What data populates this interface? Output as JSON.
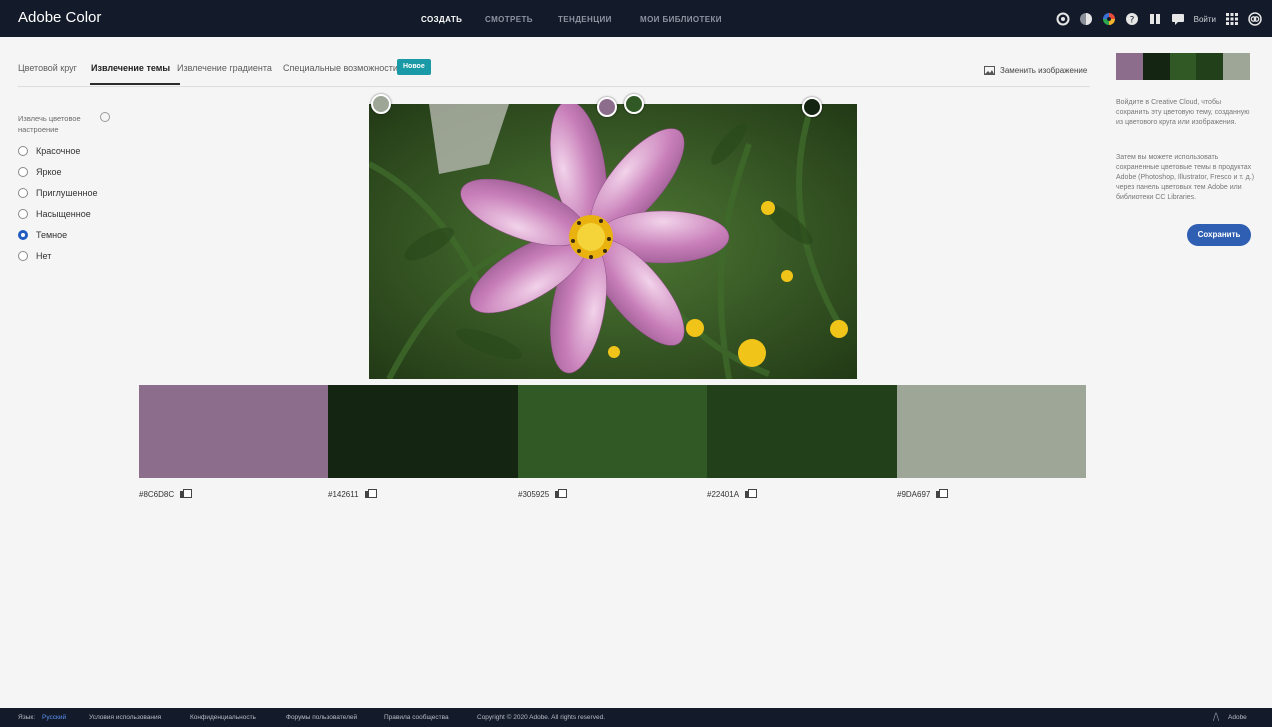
{
  "app": {
    "title": "Adobe Color"
  },
  "topnav": {
    "items": [
      {
        "label": "СОЗДАТЬ",
        "active": true
      },
      {
        "label": "СМОТРЕТЬ",
        "active": false
      },
      {
        "label": "ТЕНДЕНЦИИ",
        "active": false
      },
      {
        "label": "МОИ БИБЛИОТЕКИ",
        "active": false
      }
    ],
    "signin": "Войти",
    "icons": [
      "settings-icon",
      "contrast-icon",
      "color-wheel-icon",
      "help-icon",
      "library-icon",
      "chat-icon",
      "apps-grid-icon",
      "creative-cloud-icon"
    ]
  },
  "tabs": {
    "items": [
      {
        "label": "Цветовой круг",
        "active": false
      },
      {
        "label": "Извлечение темы",
        "active": true
      },
      {
        "label": "Извлечение градиента",
        "active": false
      },
      {
        "label": "Специальные возможности",
        "active": false
      }
    ],
    "new_badge": "Новое",
    "replace_image": "Заменить изображение"
  },
  "mood": {
    "label": "Извлечь цветовое настроение",
    "options": [
      {
        "label": "Красочное",
        "checked": false
      },
      {
        "label": "Яркое",
        "checked": false
      },
      {
        "label": "Приглушенное",
        "checked": false
      },
      {
        "label": "Насыщенное",
        "checked": false
      },
      {
        "label": "Темное",
        "checked": true
      },
      {
        "label": "Нет",
        "checked": false
      }
    ]
  },
  "palette": {
    "colors": [
      "#8C6D8C",
      "#142611",
      "#305925",
      "#22401A",
      "#9DA697"
    ],
    "hex_labels": [
      "#8C6D8C",
      "#142611",
      "#305925",
      "#22401A",
      "#9DA697"
    ]
  },
  "right_panel": {
    "text1": "Войдите в Creative Cloud, чтобы сохранить эту цветовую тему, созданную из цветового круга или изображения.",
    "text2": "Затем вы можете использовать сохраненные цветовые темы в продуктах Adobe (Photoshop, Illustrator, Fresco и т. д.) через панель цветовых тем Adobe или библиотеки CC Libraries.",
    "save_label": "Сохранить"
  },
  "footer": {
    "language_label": "Язык:",
    "language_value": "Русский",
    "links": [
      "Условия использования",
      "Конфиденциальность",
      "Форумы пользователей",
      "Правила сообщества"
    ],
    "copyright": "Copyright © 2020 Adobe. All rights reserved.",
    "brand": "Adobe"
  }
}
